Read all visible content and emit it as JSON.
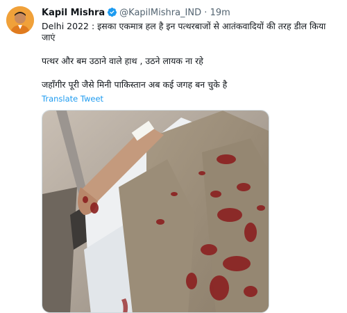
{
  "tweet": {
    "author_name": "Kapil Mishra",
    "handle": "@KapilMishra_IND",
    "separator": "·",
    "timestamp": "19m",
    "text_lines": [
      "Delhi 2022 : इसका एकमात्र हल है इन पत्थरबाजों से आतंकवादियों की तरह डील किया जाएं",
      "पत्थर और बम उठाने वाले हाथ , उठने लायक ना रहे",
      "जहाँगीर पूरी जैसे मिनी पाकिस्तान अब कई जगह बन चुके है"
    ],
    "translate_label": "Translate Tweet",
    "icons": {
      "verified": "verified-badge-icon",
      "avatar": "profile-avatar"
    },
    "colors": {
      "link": "#1d9bf0",
      "secondary_text": "#536471",
      "verified": "#1d9bf0"
    }
  }
}
